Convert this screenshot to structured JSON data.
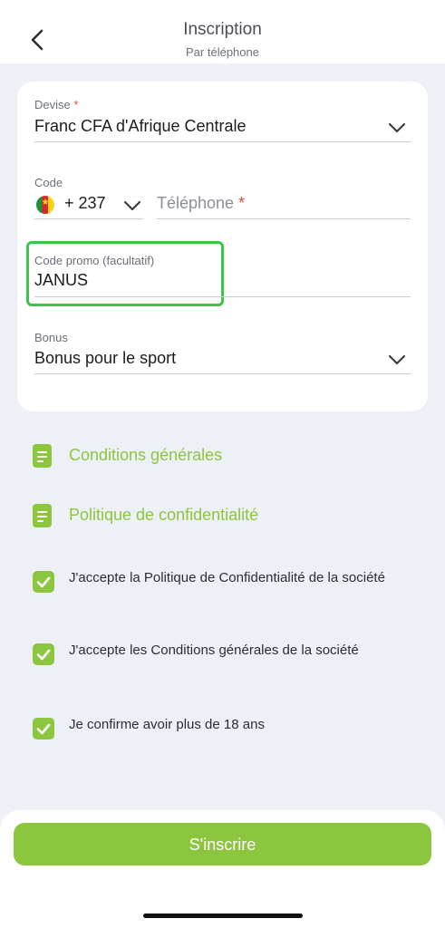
{
  "header": {
    "title": "Inscription",
    "subtitle": "Par téléphone"
  },
  "form": {
    "currency": {
      "label": "Devise",
      "required_mark": "*",
      "value": "Franc CFA d'Afrique Centrale"
    },
    "code": {
      "label": "Code",
      "value": "+ 237"
    },
    "phone": {
      "placeholder": "Téléphone",
      "required_mark": "*"
    },
    "promo": {
      "label": "Code promo (facultatif)",
      "value": "JANUS"
    },
    "bonus": {
      "label": "Bonus",
      "value": "Bonus pour le sport"
    }
  },
  "links": [
    {
      "label": "Conditions générales"
    },
    {
      "label": "Politique de confidentialité"
    }
  ],
  "checkboxes": [
    {
      "label": "J'accepte la Politique de Confidentialité de la société",
      "checked": true
    },
    {
      "label": "J'accepte les Conditions générales de la société",
      "checked": true
    },
    {
      "label": "Je confirme avoir plus de 18 ans",
      "checked": true
    }
  ],
  "submit": {
    "label": "S'inscrire"
  },
  "colors": {
    "accent": "#8cc63f",
    "highlight": "#3ec44b",
    "required": "#e0453e",
    "background": "#edf0f4"
  },
  "icons": {
    "back": "chevron-left-icon",
    "dropdown": "chevron-down-icon",
    "document": "document-icon",
    "check": "checkmark-icon"
  }
}
